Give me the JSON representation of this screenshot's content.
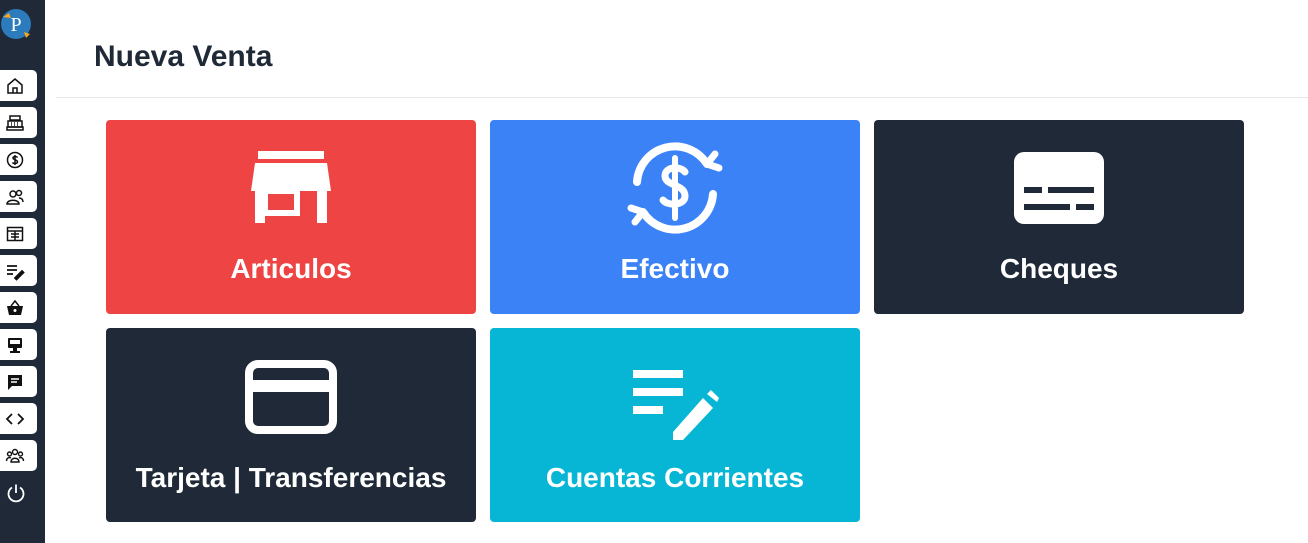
{
  "app": {
    "logo_letter": "P"
  },
  "sidebar": {
    "items": [
      {
        "name": "home",
        "icon": "home-icon"
      },
      {
        "name": "cash-register",
        "icon": "cash-register-icon"
      },
      {
        "name": "dollar",
        "icon": "dollar-circle-icon"
      },
      {
        "name": "users",
        "icon": "users-icon"
      },
      {
        "name": "calendar",
        "icon": "calendar-icon"
      },
      {
        "name": "edit-list",
        "icon": "edit-list-icon"
      },
      {
        "name": "basket",
        "icon": "basket-icon"
      },
      {
        "name": "point-of-sale",
        "icon": "pos-icon"
      },
      {
        "name": "messages",
        "icon": "message-icon"
      },
      {
        "name": "code",
        "icon": "code-icon"
      },
      {
        "name": "group",
        "icon": "group-icon"
      }
    ],
    "power_icon": "power-icon"
  },
  "header": {
    "title": "Nueva Venta"
  },
  "tiles": [
    {
      "label": "Articulos",
      "icon": "store-icon",
      "color": "#ef4444"
    },
    {
      "label": "Efectivo",
      "icon": "dollar-exchange-icon",
      "color": "#3b82f6"
    },
    {
      "label": "Cheques",
      "icon": "check-card-icon",
      "color": "#1f2937"
    },
    {
      "label": "Tarjeta | Transferencias",
      "icon": "credit-card-icon",
      "color": "#1f2937"
    },
    {
      "label": "Cuentas Corrientes",
      "icon": "edit-list-icon",
      "color": "#06b6d4"
    }
  ]
}
